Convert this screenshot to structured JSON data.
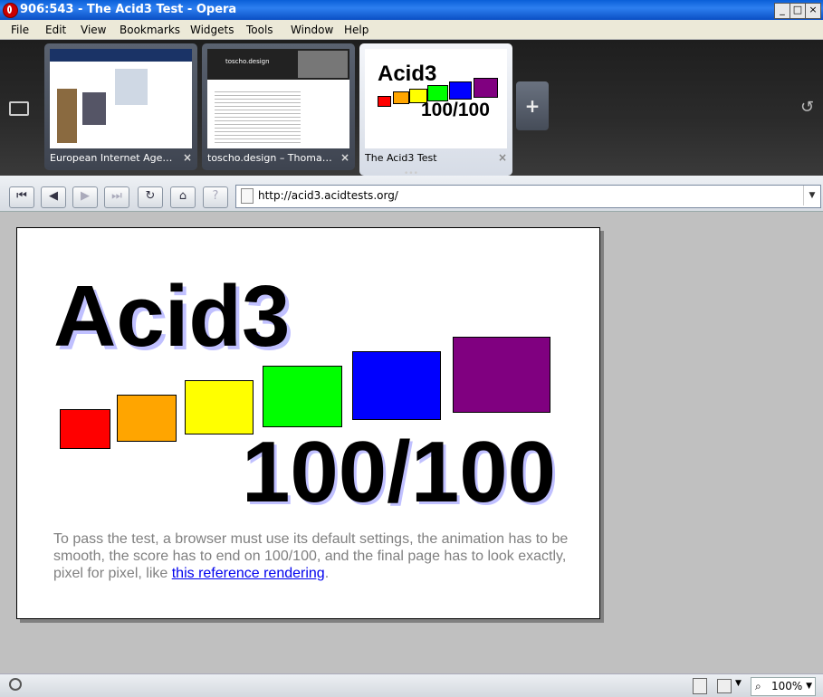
{
  "window": {
    "title": "906:543 - The Acid3 Test - Opera"
  },
  "menu": [
    "File",
    "Edit",
    "View",
    "Bookmarks",
    "Widgets",
    "Tools",
    "Window",
    "Help"
  ],
  "tabs": [
    {
      "title": "European Internet Agency...",
      "active": false
    },
    {
      "title": "toscho.design – Thomas ...",
      "active": false
    },
    {
      "title": "The Acid3 Test",
      "active": true
    }
  ],
  "thumbs": {
    "t2_heading": "toscho.design",
    "t3_title": "Acid3",
    "t3_score": "100/100"
  },
  "address": {
    "url": "http://acid3.acidtests.org/"
  },
  "page": {
    "title": "Acid3",
    "score": "100/100",
    "desc_before": "To pass the test, a browser must use its default settings, the animation has to be smooth, the score has to end on 100/100, and the final page has to look exactly, pixel for pixel, like ",
    "link_text": "this reference rendering",
    "desc_after": "."
  },
  "colors": {
    "box1": "#ff0000",
    "box2": "#ffa500",
    "box3": "#ffff00",
    "box4": "#00ff00",
    "box5": "#0000ff",
    "box6": "#800080",
    "link": "#0000ee"
  },
  "status": {
    "zoom": "100%"
  }
}
